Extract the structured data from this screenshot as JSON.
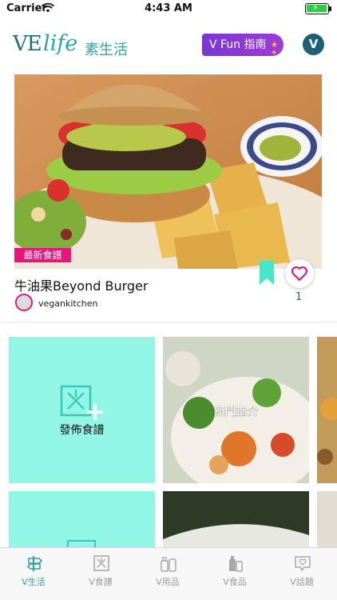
{
  "status_bar": {
    "carrier": "Carrier",
    "time": "4:43 AM"
  },
  "header": {
    "logo_ve": "VE",
    "logo_life": "life",
    "logo_zh": "素生活",
    "guide_button": "V Fun 指南",
    "user_initial": "V"
  },
  "featured": {
    "tag": "最新食譜",
    "title": "牛油果Beyond Burger",
    "author": "vegankitchen",
    "likes": "1"
  },
  "tiles": {
    "publish_label": "發佈食譜",
    "hot_label": "熱門推介"
  },
  "tabbar": {
    "items": [
      {
        "label": "V生活",
        "icon": "signpost-icon",
        "active": true
      },
      {
        "label": "V食譜",
        "icon": "recipe-icon",
        "active": false
      },
      {
        "label": "V用品",
        "icon": "products-icon",
        "active": false
      },
      {
        "label": "V食品",
        "icon": "food-icon",
        "active": false
      },
      {
        "label": "V話題",
        "icon": "topic-icon",
        "active": false
      }
    ]
  },
  "colors": {
    "brand_teal": "#2aa5a8",
    "brand_dark": "#1d6f7a",
    "tile_mint": "#91f6e6",
    "accent_pink": "#e4187a",
    "guide_purple": "#8a3ad6"
  }
}
